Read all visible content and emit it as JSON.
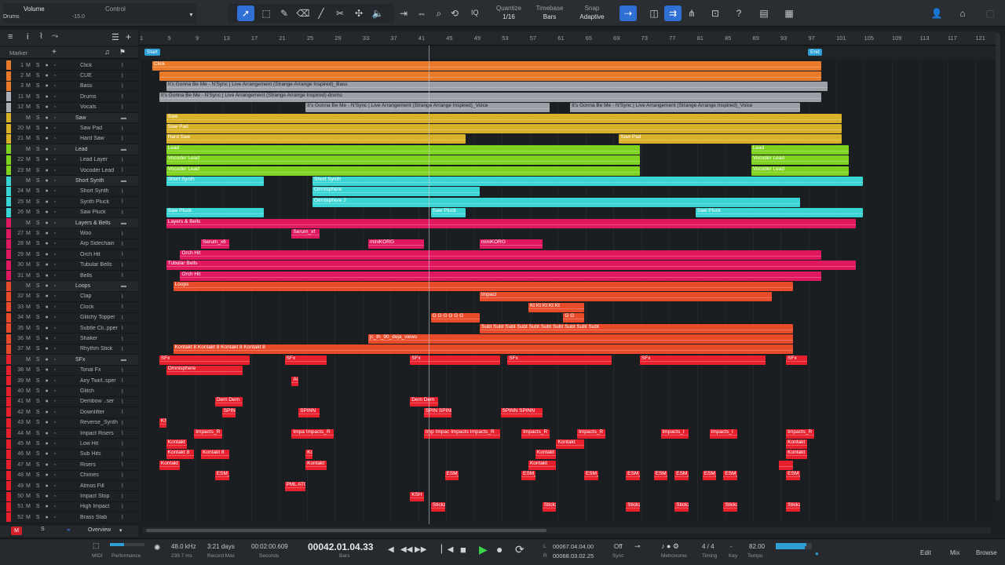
{
  "toolbar": {
    "channel_name": "Volume",
    "channel_sub": "Drums",
    "volume_value": "-15.0",
    "control_label": "Control",
    "quantize_label": "Quantize",
    "quantize_value": "1/16",
    "timebase_label": "Timebase",
    "timebase_value": "Bars",
    "snap_label": "Snap",
    "snap_value": "Adaptive",
    "iq_label": "IQ"
  },
  "ruler": {
    "ticks": [
      "1",
      "5",
      "9",
      "13",
      "17",
      "21",
      "25",
      "29",
      "33",
      "37",
      "41",
      "45",
      "49",
      "53",
      "57",
      "61",
      "65",
      "69",
      "73",
      "77",
      "81",
      "85",
      "89",
      "93",
      "97",
      "101",
      "105",
      "109",
      "113",
      "117",
      "121"
    ]
  },
  "markers": {
    "label": "Marker",
    "start": "Start",
    "end": "End"
  },
  "tracks": [
    {
      "num": "1",
      "name": "Click",
      "color": "#e87a2a"
    },
    {
      "num": "2",
      "name": "CUE",
      "color": "#e87a2a"
    },
    {
      "num": "3",
      "name": "Bass",
      "color": "#e87a2a"
    },
    {
      "num": "11",
      "name": "Drums",
      "color": "#aab0b6"
    },
    {
      "num": "12",
      "name": "Vocals",
      "color": "#aab0b6"
    },
    {
      "num": "",
      "name": "Saw",
      "color": "#d9b128",
      "folder": true
    },
    {
      "num": "20",
      "name": "Saw Pad",
      "color": "#d9b128"
    },
    {
      "num": "21",
      "name": "Hard Saw",
      "color": "#d9b128"
    },
    {
      "num": "",
      "name": "Lead",
      "color": "#7ed321",
      "folder": true
    },
    {
      "num": "22",
      "name": "Lead Layer",
      "color": "#7ed321"
    },
    {
      "num": "23",
      "name": "Vocoder Lead",
      "color": "#7ed321"
    },
    {
      "num": "",
      "name": "Short Synth",
      "color": "#3bd4d4",
      "folder": true
    },
    {
      "num": "24",
      "name": "Short Synth",
      "color": "#3bd4d4"
    },
    {
      "num": "25",
      "name": "Synth Pluck",
      "color": "#3bd4d4"
    },
    {
      "num": "26",
      "name": "Saw Pluck",
      "color": "#3bd4d4"
    },
    {
      "num": "",
      "name": "Layers & Bells",
      "color": "#e0195f",
      "folder": true
    },
    {
      "num": "27",
      "name": "Woo",
      "color": "#e0195f"
    },
    {
      "num": "28",
      "name": "Arp Sidechain",
      "color": "#e0195f"
    },
    {
      "num": "29",
      "name": "Orch Hit",
      "color": "#e0195f"
    },
    {
      "num": "30",
      "name": "Tubular Bells",
      "color": "#e0195f"
    },
    {
      "num": "31",
      "name": "Bells",
      "color": "#e0195f"
    },
    {
      "num": "",
      "name": "Loops",
      "color": "#e84a2a",
      "folder": true
    },
    {
      "num": "32",
      "name": "Clap",
      "color": "#e84a2a"
    },
    {
      "num": "33",
      "name": "Clock",
      "color": "#e84a2a"
    },
    {
      "num": "34",
      "name": "Glitchy Topper",
      "color": "#e84a2a"
    },
    {
      "num": "35",
      "name": "Subtle Cli..pper",
      "color": "#e84a2a"
    },
    {
      "num": "36",
      "name": "Shaker",
      "color": "#e84a2a"
    },
    {
      "num": "37",
      "name": "Rhythm Stick",
      "color": "#e84a2a"
    },
    {
      "num": "",
      "name": "SFx",
      "color": "#e8202e",
      "folder": true
    },
    {
      "num": "38",
      "name": "Tonal Fx",
      "color": "#e8202e"
    },
    {
      "num": "39",
      "name": "Airy Twirl..sper",
      "color": "#e8202e"
    },
    {
      "num": "40",
      "name": "Glitch",
      "color": "#e8202e"
    },
    {
      "num": "41",
      "name": "Dembow ..ser",
      "color": "#e8202e"
    },
    {
      "num": "42",
      "name": "Downlifter",
      "color": "#e8202e"
    },
    {
      "num": "43",
      "name": "Reverse_Synth",
      "color": "#e8202e"
    },
    {
      "num": "44",
      "name": "Impact Risers",
      "color": "#e8202e"
    },
    {
      "num": "45",
      "name": "Low Hit",
      "color": "#e8202e"
    },
    {
      "num": "46",
      "name": "Sub Hits",
      "color": "#e8202e"
    },
    {
      "num": "47",
      "name": "Risers",
      "color": "#e8202e"
    },
    {
      "num": "48",
      "name": "Chimes",
      "color": "#e8202e"
    },
    {
      "num": "49",
      "name": "Atmos Fill",
      "color": "#e8202e"
    },
    {
      "num": "50",
      "name": "Impact Stop",
      "color": "#e8202e"
    },
    {
      "num": "51",
      "name": "High Impact",
      "color": "#e8202e"
    },
    {
      "num": "52",
      "name": "Brass Stab",
      "color": "#e8202e"
    }
  ],
  "clips": [
    {
      "row": 0,
      "bar": 1,
      "len": 96,
      "label": "Click",
      "color": "#e87a2a"
    },
    {
      "row": 1,
      "bar": 2,
      "len": 95,
      "label": "",
      "color": "#e87a2a"
    },
    {
      "row": 2,
      "bar": 3,
      "len": 95,
      "label": "It's Gonna Be Me - N'Sync  |  Live Arrangement (Strange Arrange Inspired)_Bass",
      "color": "#9aa0a6"
    },
    {
      "row": 3,
      "bar": 2,
      "len": 95,
      "label": "It's Gonna Be Me - N'Sync  |  Live Arrangement (Strange Arrange Inspired)-drums",
      "color": "#9aa0a6"
    },
    {
      "row": 4,
      "bar": 23,
      "len": 35,
      "label": "It's Gonna Be Me - N'Sync  |  Live Arrangement (Strange Arrange Inspired)_Voice",
      "color": "#9aa0a6"
    },
    {
      "row": 4,
      "bar": 61,
      "len": 33,
      "label": "It's Gonna Be Me - N'Sync  |  Live Arrangement (Strange Arrange Inspired)_Voice",
      "color": "#9aa0a6"
    },
    {
      "row": 5,
      "bar": 3,
      "len": 97,
      "label": "Saw",
      "color": "#d9b128"
    },
    {
      "row": 6,
      "bar": 3,
      "len": 97,
      "label": "Saw Pad",
      "color": "#d9b128"
    },
    {
      "row": 7,
      "bar": 3,
      "len": 43,
      "label": "Hard Saw",
      "color": "#d9b128"
    },
    {
      "row": 7,
      "bar": 68,
      "len": 32,
      "label": "Saw Pad",
      "color": "#d9b128"
    },
    {
      "row": 8,
      "bar": 3,
      "len": 68,
      "label": "Lead",
      "color": "#7ed321"
    },
    {
      "row": 8,
      "bar": 87,
      "len": 14,
      "label": "Lead",
      "color": "#7ed321"
    },
    {
      "row": 9,
      "bar": 3,
      "len": 68,
      "label": "Vocoder Lead",
      "color": "#7ed321"
    },
    {
      "row": 9,
      "bar": 87,
      "len": 14,
      "label": "Vocoder Lead",
      "color": "#7ed321"
    },
    {
      "row": 10,
      "bar": 3,
      "len": 68,
      "label": "Vocoder Lead",
      "color": "#7ed321"
    },
    {
      "row": 10,
      "bar": 87,
      "len": 14,
      "label": "Vocoder Lead",
      "color": "#7ed321"
    },
    {
      "row": 11,
      "bar": 3,
      "len": 14,
      "label": "Short Synth",
      "color": "#3bd4d4"
    },
    {
      "row": 11,
      "bar": 24,
      "len": 79,
      "label": "Short Synth",
      "color": "#3bd4d4"
    },
    {
      "row": 12,
      "bar": 24,
      "len": 24,
      "label": "Omnisphere",
      "color": "#3bd4d4"
    },
    {
      "row": 13,
      "bar": 24,
      "len": 70,
      "label": "Omnisphere 2",
      "color": "#3bd4d4"
    },
    {
      "row": 14,
      "bar": 3,
      "len": 14,
      "label": "Saw Pluck",
      "color": "#3bd4d4"
    },
    {
      "row": 14,
      "bar": 41,
      "len": 5,
      "label": "Saw Pluck",
      "color": "#3bd4d4"
    },
    {
      "row": 14,
      "bar": 79,
      "len": 24,
      "label": "Saw Pluck",
      "color": "#3bd4d4"
    },
    {
      "row": 15,
      "bar": 3,
      "len": 99,
      "label": "Layers & Bells",
      "color": "#e0195f"
    },
    {
      "row": 16,
      "bar": 21,
      "len": 4,
      "label": "Serum_xf",
      "color": "#e0195f"
    },
    {
      "row": 17,
      "bar": 8,
      "len": 4,
      "label": "Serum_x6",
      "color": "#e0195f"
    },
    {
      "row": 17,
      "bar": 32,
      "len": 8,
      "label": "miniKORG",
      "color": "#e0195f"
    },
    {
      "row": 17,
      "bar": 48,
      "len": 9,
      "label": "miniKORG",
      "color": "#e0195f"
    },
    {
      "row": 18,
      "bar": 5,
      "len": 92,
      "label": "Orch Hit",
      "color": "#e0195f"
    },
    {
      "row": 19,
      "bar": 3,
      "len": 99,
      "label": "Tubular Bells",
      "color": "#e0195f"
    },
    {
      "row": 20,
      "bar": 5,
      "len": 92,
      "label": "Orch Hit",
      "color": "#e0195f"
    },
    {
      "row": 21,
      "bar": 4,
      "len": 89,
      "label": "Loops",
      "color": "#e84a2a"
    },
    {
      "row": 22,
      "bar": 48,
      "len": 42,
      "label": "Impact",
      "color": "#e84a2a"
    },
    {
      "row": 23,
      "bar": 55,
      "len": 8,
      "label": "Kt Kt Kt Kt Kt",
      "color": "#e84a2a"
    },
    {
      "row": 24,
      "bar": 41,
      "len": 7,
      "label": "G G G G G G",
      "color": "#e84a2a"
    },
    {
      "row": 24,
      "bar": 60,
      "len": 3,
      "label": "G G",
      "color": "#e84a2a"
    },
    {
      "row": 25,
      "bar": 48,
      "len": 45,
      "label": "Subt Subt Subt Subt Subt Subt Subt Subt Subt Subt",
      "color": "#e84a2a"
    },
    {
      "row": 26,
      "bar": 32,
      "len": 61,
      "label": "jc_th_90_deja_views",
      "color": "#e84a2a"
    },
    {
      "row": 27,
      "bar": 4,
      "len": 89,
      "label": "Kontakt 8 Kontakt 8 Kontakt 8 Kontakt 8",
      "color": "#e84a2a"
    },
    {
      "row": 28,
      "bar": 2,
      "len": 13,
      "label": "SFx",
      "color": "#e8202e"
    },
    {
      "row": 28,
      "bar": 20,
      "len": 6,
      "label": "SFx",
      "color": "#e8202e"
    },
    {
      "row": 28,
      "bar": 38,
      "len": 13,
      "label": "SFx",
      "color": "#e8202e"
    },
    {
      "row": 28,
      "bar": 52,
      "len": 15,
      "label": "SFx",
      "color": "#e8202e"
    },
    {
      "row": 28,
      "bar": 71,
      "len": 18,
      "label": "SFx",
      "color": "#e8202e"
    },
    {
      "row": 28,
      "bar": 92,
      "len": 3,
      "label": "SFx",
      "color": "#e8202e"
    },
    {
      "row": 29,
      "bar": 3,
      "len": 11,
      "label": "Omnisphere",
      "color": "#e8202e"
    },
    {
      "row": 30,
      "bar": 21,
      "len": 1,
      "label": "Ai",
      "color": "#e8202e"
    },
    {
      "row": 32,
      "bar": 10,
      "len": 4,
      "label": "Dem Dem",
      "color": "#e8202e"
    },
    {
      "row": 32,
      "bar": 38,
      "len": 4,
      "label": "Dem Dem",
      "color": "#e8202e"
    },
    {
      "row": 33,
      "bar": 11,
      "len": 2,
      "label": "SPINN",
      "color": "#e8202e"
    },
    {
      "row": 33,
      "bar": 22,
      "len": 3,
      "label": "SPINN",
      "color": "#e8202e"
    },
    {
      "row": 33,
      "bar": 40,
      "len": 4,
      "label": "SPIN SPINN",
      "color": "#e8202e"
    },
    {
      "row": 33,
      "bar": 51,
      "len": 6,
      "label": "SPINN SPINN",
      "color": "#e8202e"
    },
    {
      "row": 34,
      "bar": 2,
      "len": 1,
      "label": "KS",
      "color": "#e8202e"
    },
    {
      "row": 35,
      "bar": 7,
      "len": 4,
      "label": "Impacts_R",
      "color": "#e8202e"
    },
    {
      "row": 35,
      "bar": 21,
      "len": 6,
      "label": "Impa Impacts_R",
      "color": "#e8202e"
    },
    {
      "row": 35,
      "bar": 40,
      "len": 11,
      "label": "Imp Impac Impacts Impacts_R",
      "color": "#e8202e"
    },
    {
      "row": 35,
      "bar": 54,
      "len": 4,
      "label": "Impacts_R",
      "color": "#e8202e"
    },
    {
      "row": 35,
      "bar": 62,
      "len": 4,
      "label": "Impacts_R",
      "color": "#e8202e"
    },
    {
      "row": 35,
      "bar": 74,
      "len": 4,
      "label": "Impacts_I",
      "color": "#e8202e"
    },
    {
      "row": 35,
      "bar": 81,
      "len": 4,
      "label": "Impacts_I",
      "color": "#e8202e"
    },
    {
      "row": 35,
      "bar": 92,
      "len": 4,
      "label": "Impacts_R",
      "color": "#e8202e"
    },
    {
      "row": 36,
      "bar": 3,
      "len": 3,
      "label": "Kontakt",
      "color": "#e8202e"
    },
    {
      "row": 36,
      "bar": 59,
      "len": 4,
      "label": "Kontakt",
      "color": "#e8202e"
    },
    {
      "row": 36,
      "bar": 92,
      "len": 3,
      "label": "Kontakt",
      "color": "#e8202e"
    },
    {
      "row": 37,
      "bar": 3,
      "len": 4,
      "label": "Kontakt 8",
      "color": "#e8202e"
    },
    {
      "row": 37,
      "bar": 8,
      "len": 4,
      "label": "Kontakt 8",
      "color": "#e8202e"
    },
    {
      "row": 37,
      "bar": 23,
      "len": 1,
      "label": "Ko",
      "color": "#e8202e"
    },
    {
      "row": 37,
      "bar": 56,
      "len": 3,
      "label": "Kontakt",
      "color": "#e8202e"
    },
    {
      "row": 37,
      "bar": 92,
      "len": 3,
      "label": "Kontakt",
      "color": "#e8202e"
    },
    {
      "row": 38,
      "bar": 2,
      "len": 3,
      "label": "Kontakt",
      "color": "#e8202e"
    },
    {
      "row": 38,
      "bar": 23,
      "len": 3,
      "label": "Kontakt",
      "color": "#e8202e"
    },
    {
      "row": 38,
      "bar": 55,
      "len": 4,
      "label": "Kontakt",
      "color": "#e8202e"
    },
    {
      "row": 38,
      "bar": 91,
      "len": 2,
      "label": "",
      "color": "#e8202e"
    },
    {
      "row": 39,
      "bar": 10,
      "len": 2,
      "label": "ESM_",
      "color": "#e8202e"
    },
    {
      "row": 39,
      "bar": 43,
      "len": 2,
      "label": "ESM_",
      "color": "#e8202e"
    },
    {
      "row": 39,
      "bar": 54,
      "len": 2,
      "label": "ESM_",
      "color": "#e8202e"
    },
    {
      "row": 39,
      "bar": 63,
      "len": 2,
      "label": "ESM_",
      "color": "#e8202e"
    },
    {
      "row": 39,
      "bar": 69,
      "len": 2,
      "label": "ESM_",
      "color": "#e8202e"
    },
    {
      "row": 39,
      "bar": 73,
      "len": 2,
      "label": "ESM_",
      "color": "#e8202e"
    },
    {
      "row": 39,
      "bar": 76,
      "len": 2,
      "label": "ESM_",
      "color": "#e8202e"
    },
    {
      "row": 39,
      "bar": 80,
      "len": 2,
      "label": "ESM_",
      "color": "#e8202e"
    },
    {
      "row": 39,
      "bar": 83,
      "len": 2,
      "label": "ESM_",
      "color": "#e8202e"
    },
    {
      "row": 39,
      "bar": 92,
      "len": 2,
      "label": "ESM_",
      "color": "#e8202e"
    },
    {
      "row": 40,
      "bar": 20,
      "len": 3,
      "label": "PML ATC",
      "color": "#e8202e"
    },
    {
      "row": 41,
      "bar": 38,
      "len": 2,
      "label": "KSH",
      "color": "#e8202e"
    },
    {
      "row": 42,
      "bar": 41,
      "len": 2,
      "label": "Stickz",
      "color": "#e8202e"
    },
    {
      "row": 42,
      "bar": 57,
      "len": 2,
      "label": "Stickz",
      "color": "#e8202e"
    },
    {
      "row": 42,
      "bar": 69,
      "len": 2,
      "label": "Stickz",
      "color": "#e8202e"
    },
    {
      "row": 42,
      "bar": 76,
      "len": 2,
      "label": "Stickz",
      "color": "#e8202e"
    },
    {
      "row": 42,
      "bar": 83,
      "len": 2,
      "label": "Stickz",
      "color": "#e8202e"
    },
    {
      "row": 42,
      "bar": 92,
      "len": 2,
      "label": "Stickz",
      "color": "#e8202e"
    }
  ],
  "transport": {
    "sample_rate": "48.0 kHz",
    "latency": "239.7 ms",
    "record_days": "3:21 days",
    "record_max": "Record Max",
    "seconds_value": "00:02:00.609",
    "seconds_label": "Seconds",
    "bars_value": "00042.01.04.33",
    "bars_label": "Bars",
    "loop_start": "00067.04.04.00",
    "loop_end": "00068.03.02.25",
    "sync_value": "Off",
    "sync_label": "Sync",
    "metronome_label": "Metronome",
    "timing_value": "4 / 4",
    "timing_label": "Timing",
    "key_value": "-",
    "key_label": "Key",
    "tempo_value": "82.00",
    "tempo_label": "Tempo",
    "midi_label": "MIDI",
    "performance_label": "Performance",
    "edit_label": "Edit",
    "mix_label": "Mix",
    "browse_label": "Browse",
    "overview_label": "Overview"
  }
}
